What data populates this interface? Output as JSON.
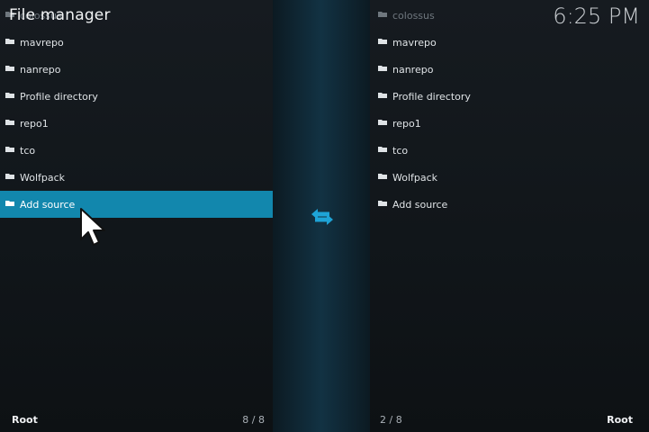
{
  "header": {
    "title": "File manager",
    "clock": "6:25 PM"
  },
  "left_pane": {
    "items": [
      {
        "label": "colossus",
        "dim": true
      },
      {
        "label": "mavrepo"
      },
      {
        "label": "nanrepo"
      },
      {
        "label": "Profile directory"
      },
      {
        "label": "repo1"
      },
      {
        "label": "tco"
      },
      {
        "label": "Wolfpack"
      },
      {
        "label": "Add source",
        "selected": true
      }
    ],
    "footer": {
      "root": "Root",
      "count": "8 / 8"
    }
  },
  "right_pane": {
    "items": [
      {
        "label": "colossus",
        "dim": true
      },
      {
        "label": "mavrepo"
      },
      {
        "label": "nanrepo"
      },
      {
        "label": "Profile directory"
      },
      {
        "label": "repo1"
      },
      {
        "label": "tco"
      },
      {
        "label": "Wolfpack"
      },
      {
        "label": "Add source"
      }
    ],
    "footer": {
      "root": "Root",
      "count": "2 / 8"
    }
  },
  "icons": {
    "folder": "folder-icon",
    "swap": "swap-arrows-icon",
    "cursor": "mouse-pointer-icon"
  },
  "colors": {
    "accent": "#1287ad",
    "swap_icon": "#1ea3d6"
  }
}
